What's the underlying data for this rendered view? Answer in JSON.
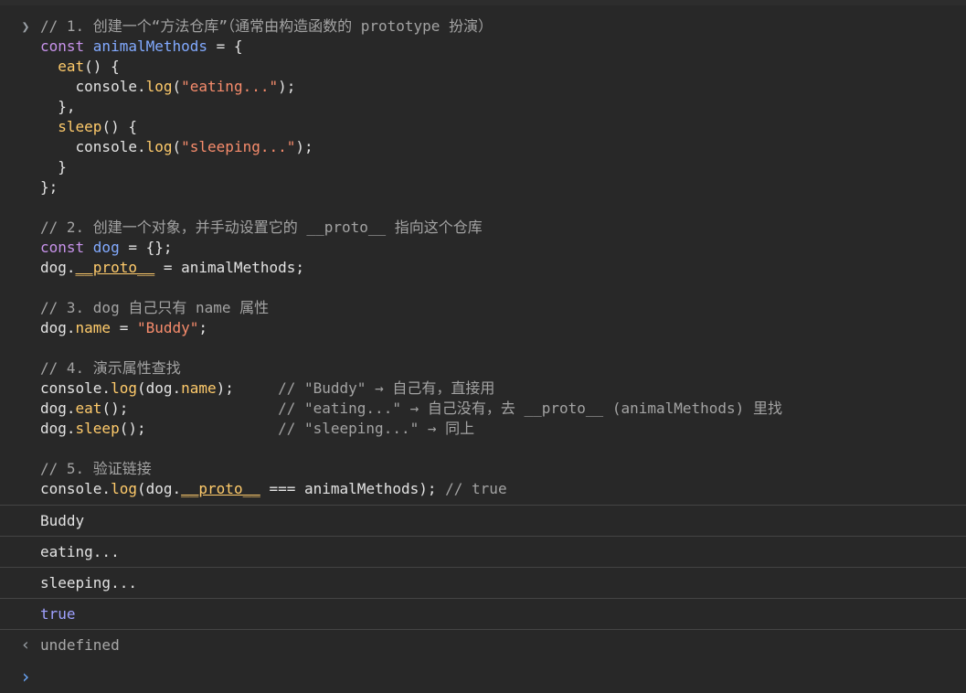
{
  "code_lines": [
    {
      "parts": [
        {
          "cls": "c",
          "text": "// 1. 创建一个“方法仓库”（通常由构造函数的 prototype 扮演）"
        }
      ]
    },
    {
      "parts": [
        {
          "cls": "k",
          "text": "const "
        },
        {
          "cls": "v",
          "text": "animalMethods"
        },
        {
          "cls": "t",
          "text": " = {"
        }
      ]
    },
    {
      "parts": [
        {
          "cls": "t",
          "text": "  "
        },
        {
          "cls": "p",
          "text": "eat"
        },
        {
          "cls": "t",
          "text": "() {"
        }
      ]
    },
    {
      "parts": [
        {
          "cls": "t",
          "text": "    console."
        },
        {
          "cls": "p",
          "text": "log"
        },
        {
          "cls": "t",
          "text": "("
        },
        {
          "cls": "s",
          "text": "\"eating...\""
        },
        {
          "cls": "t",
          "text": ");"
        }
      ]
    },
    {
      "parts": [
        {
          "cls": "t",
          "text": "  },"
        }
      ]
    },
    {
      "parts": [
        {
          "cls": "t",
          "text": "  "
        },
        {
          "cls": "p",
          "text": "sleep"
        },
        {
          "cls": "t",
          "text": "() {"
        }
      ]
    },
    {
      "parts": [
        {
          "cls": "t",
          "text": "    console."
        },
        {
          "cls": "p",
          "text": "log"
        },
        {
          "cls": "t",
          "text": "("
        },
        {
          "cls": "s",
          "text": "\"sleeping...\""
        },
        {
          "cls": "t",
          "text": ");"
        }
      ]
    },
    {
      "parts": [
        {
          "cls": "t",
          "text": "  }"
        }
      ]
    },
    {
      "parts": [
        {
          "cls": "t",
          "text": "};"
        }
      ]
    },
    {
      "parts": [
        {
          "cls": "t",
          "text": ""
        }
      ]
    },
    {
      "parts": [
        {
          "cls": "c",
          "text": "// 2. 创建一个对象，并手动设置它的 __proto__ 指向这个仓库"
        }
      ]
    },
    {
      "parts": [
        {
          "cls": "k",
          "text": "const "
        },
        {
          "cls": "v",
          "text": "dog"
        },
        {
          "cls": "t",
          "text": " = {};"
        }
      ]
    },
    {
      "parts": [
        {
          "cls": "t",
          "text": "dog."
        },
        {
          "cls": "p u",
          "text": "__proto__"
        },
        {
          "cls": "t",
          "text": " = animalMethods;"
        }
      ]
    },
    {
      "parts": [
        {
          "cls": "t",
          "text": ""
        }
      ]
    },
    {
      "parts": [
        {
          "cls": "c",
          "text": "// 3. dog 自己只有 name 属性"
        }
      ]
    },
    {
      "parts": [
        {
          "cls": "t",
          "text": "dog."
        },
        {
          "cls": "p",
          "text": "name"
        },
        {
          "cls": "t",
          "text": " = "
        },
        {
          "cls": "s",
          "text": "\"Buddy\""
        },
        {
          "cls": "t",
          "text": ";"
        }
      ]
    },
    {
      "parts": [
        {
          "cls": "t",
          "text": ""
        }
      ]
    },
    {
      "parts": [
        {
          "cls": "c",
          "text": "// 4. 演示属性查找"
        }
      ]
    },
    {
      "parts": [
        {
          "cls": "t",
          "text": "console."
        },
        {
          "cls": "p",
          "text": "log"
        },
        {
          "cls": "t",
          "text": "(dog."
        },
        {
          "cls": "p",
          "text": "name"
        },
        {
          "cls": "t",
          "text": ");     "
        },
        {
          "cls": "c",
          "text": "// \"Buddy\" → 自己有，直接用"
        }
      ]
    },
    {
      "parts": [
        {
          "cls": "t",
          "text": "dog."
        },
        {
          "cls": "p",
          "text": "eat"
        },
        {
          "cls": "t",
          "text": "();                 "
        },
        {
          "cls": "c",
          "text": "// \"eating...\" → 自己没有，去 __proto__ (animalMethods) 里找"
        }
      ]
    },
    {
      "parts": [
        {
          "cls": "t",
          "text": "dog."
        },
        {
          "cls": "p",
          "text": "sleep"
        },
        {
          "cls": "t",
          "text": "();               "
        },
        {
          "cls": "c",
          "text": "// \"sleeping...\" → 同上"
        }
      ]
    },
    {
      "parts": [
        {
          "cls": "t",
          "text": ""
        }
      ]
    },
    {
      "parts": [
        {
          "cls": "c",
          "text": "// 5. 验证链接"
        }
      ]
    },
    {
      "parts": [
        {
          "cls": "t",
          "text": "console."
        },
        {
          "cls": "p",
          "text": "log"
        },
        {
          "cls": "t",
          "text": "(dog."
        },
        {
          "cls": "p u",
          "text": "__proto__"
        },
        {
          "cls": "t",
          "text": " === animalMethods); "
        },
        {
          "cls": "c",
          "text": "// true"
        }
      ]
    }
  ],
  "outputs": [
    {
      "text": "Buddy",
      "kind": "string"
    },
    {
      "text": "eating...",
      "kind": "string"
    },
    {
      "text": "sleeping...",
      "kind": "string"
    },
    {
      "text": "true",
      "kind": "boolean"
    }
  ],
  "return_value": "undefined",
  "glyphs": {
    "input_prompt": "❯",
    "return_arrow": "‹",
    "new_prompt": "›"
  }
}
